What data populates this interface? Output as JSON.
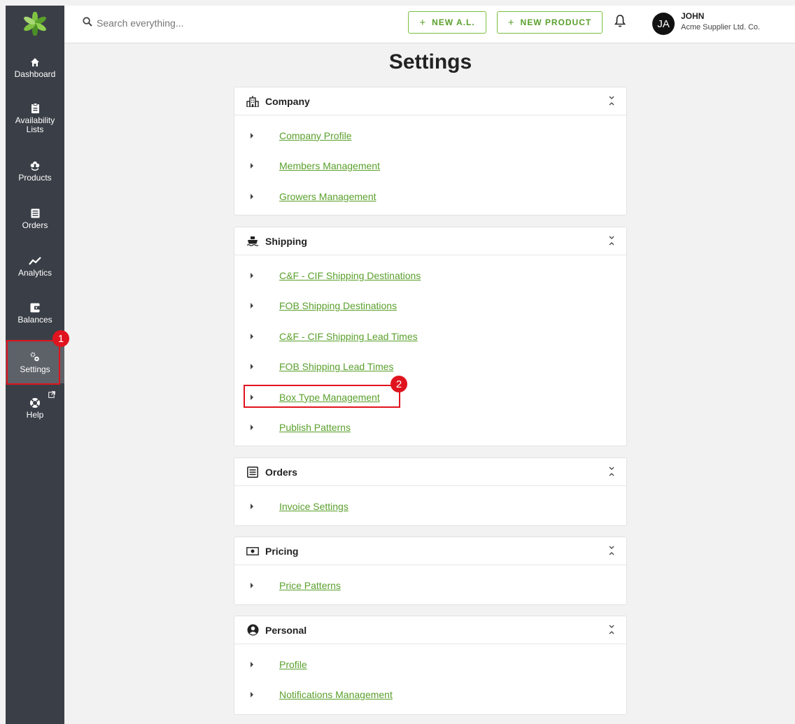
{
  "search": {
    "placeholder": "Search everything..."
  },
  "topbar": {
    "new_al_label": "NEW A.L.",
    "new_product_label": "NEW PRODUCT",
    "plus": "+"
  },
  "user": {
    "initials": "JA",
    "name": "JOHN",
    "company": "Acme Supplier Ltd. Co."
  },
  "sidebar": {
    "items": [
      {
        "label": "Dashboard",
        "icon": "home-icon"
      },
      {
        "label": "Availability\nLists",
        "icon": "clipboard-icon"
      },
      {
        "label": "Products",
        "icon": "flower-icon"
      },
      {
        "label": "Orders",
        "icon": "list-icon"
      },
      {
        "label": "Analytics",
        "icon": "trend-icon"
      },
      {
        "label": "Balances",
        "icon": "wallet-icon"
      },
      {
        "label": "Settings",
        "icon": "gears-icon"
      },
      {
        "label": "Help",
        "icon": "lifebuoy-icon"
      }
    ]
  },
  "page": {
    "title": "Settings"
  },
  "sections": {
    "company": {
      "title": "Company",
      "items": [
        "Company Profile",
        "Members Management",
        "Growers Management"
      ]
    },
    "shipping": {
      "title": "Shipping",
      "items": [
        "C&F - CIF Shipping Destinations",
        "FOB Shipping Destinations",
        "C&F - CIF Shipping Lead Times",
        "FOB Shipping Lead Times",
        "Box Type Management",
        "Publish Patterns"
      ]
    },
    "orders": {
      "title": "Orders",
      "items": [
        "Invoice Settings"
      ]
    },
    "pricing": {
      "title": "Pricing",
      "items": [
        "Price Patterns"
      ]
    },
    "personal": {
      "title": "Personal",
      "items": [
        "Profile",
        "Notifications Management"
      ]
    }
  },
  "annotations": {
    "step1": "1",
    "step2": "2"
  },
  "colors": {
    "accent": "#5aa02c",
    "sidebar": "#3a3f47",
    "marker": "#e0141e"
  }
}
